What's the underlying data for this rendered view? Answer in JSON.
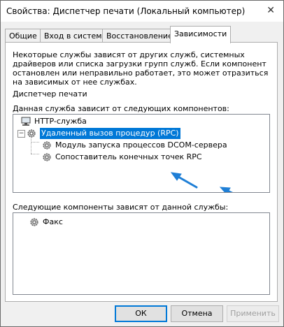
{
  "window": {
    "title": "Свойства: Диспетчер печати (Локальный компьютер)",
    "close_glyph": "✕"
  },
  "tabs": [
    "Общие",
    "Вход в систему",
    "Восстановление",
    "Зависимости"
  ],
  "active_tab": "Зависимости",
  "description": "Некоторые службы зависят от других служб, системных драйверов или списка загрузки групп служб. Если компонент остановлен или неправильно работает, это может отразиться на зависимых от нее службах.",
  "service_name": "Диспетчер печати",
  "depends_on": {
    "label": "Данная служба зависит от следующих компонентов:",
    "items": [
      {
        "label": "HTTP-служба",
        "icon": "computer-icon",
        "selected": false
      },
      {
        "label": "Удаленный вызов процедур (RPC)",
        "icon": "gear-icon",
        "selected": true,
        "expanded": true,
        "children": [
          {
            "label": "Модуль запуска процессов DCOM-сервера",
            "icon": "gear-icon"
          },
          {
            "label": "Сопоставитель конечных точек RPC",
            "icon": "gear-icon"
          }
        ]
      }
    ]
  },
  "dependents": {
    "label": "Следующие компоненты зависят от данной службы:",
    "items": [
      {
        "label": "Факс",
        "icon": "gear-icon"
      }
    ]
  },
  "buttons": {
    "ok": "ОК",
    "cancel": "Отмена",
    "apply": "Применить"
  },
  "colors": {
    "selection": "#0078d7",
    "annotation_arrow": "#1f7fd6"
  }
}
